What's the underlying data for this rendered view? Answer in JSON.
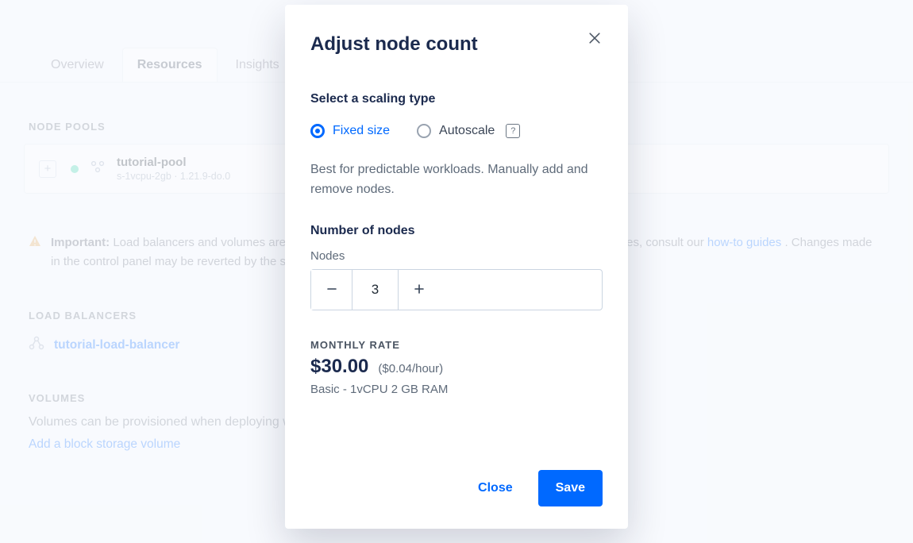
{
  "tabs": {
    "overview": "Overview",
    "resources": "Resources",
    "insights": "Insights"
  },
  "sections": {
    "node_pools": "NODE POOLS",
    "load_balancers": "LOAD BALANCERS",
    "volumes": "VOLUMES"
  },
  "node_pool": {
    "name": "tutorial-pool",
    "subtitle": "s-1vcpu-2gb · 1.21.9-do.0"
  },
  "alert": {
    "prefix": "Important:",
    "line1": " Load balancers and volumes are managed in the control panel and the cluster. To avoid sync issues, consult our ",
    "link": "how-to guides",
    "line2": ". Changes made in the control panel may be reverted by the service's reconciler or make the cluster unstable."
  },
  "load_balancer": {
    "name": "tutorial-load-balancer"
  },
  "volumes": {
    "text": "Volumes can be provisioned when deploying workloads.",
    "link": "Add a block storage volume"
  },
  "modal": {
    "title": "Adjust node count",
    "select_heading": "Select a scaling type",
    "options": {
      "fixed": "Fixed size",
      "autoscale": "Autoscale"
    },
    "hint": "Best for predictable workloads. Manually add and remove nodes.",
    "nodes_heading": "Number of nodes",
    "nodes_label": "Nodes",
    "nodes_value": "3",
    "rate_label": "MONTHLY RATE",
    "price": "$30.00",
    "price_sub": "($0.04/hour)",
    "spec": "Basic - 1vCPU 2 GB RAM",
    "close": "Close",
    "save": "Save"
  }
}
